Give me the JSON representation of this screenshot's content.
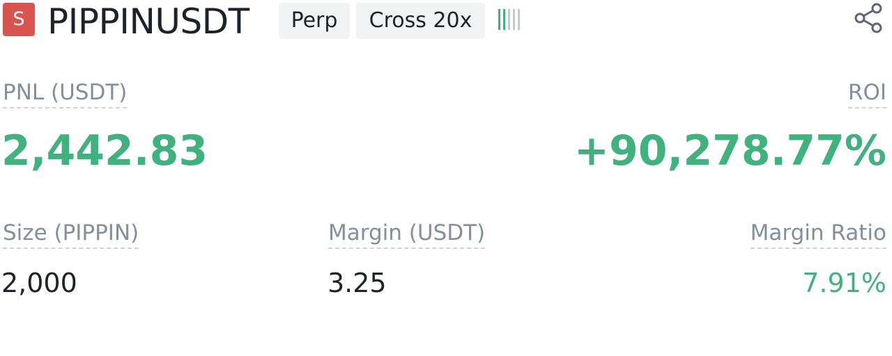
{
  "header": {
    "side_badge": "S",
    "symbol": "PIPPINUSDT",
    "contract_type": "Perp",
    "margin_mode": "Cross 20x",
    "risk_icon": "risk-level-bars-icon",
    "share_icon": "share-icon"
  },
  "pnl": {
    "label": "PNL (USDT)",
    "value": "2,442.83"
  },
  "roi": {
    "label": "ROI",
    "value": "+90,278.77%"
  },
  "size": {
    "label": "Size (PIPPIN)",
    "value": "2,000"
  },
  "margin": {
    "label": "Margin (USDT)",
    "value": "3.25"
  },
  "margin_ratio": {
    "label": "Margin Ratio",
    "value": "7.91%"
  },
  "colors": {
    "profit_green": "#3fb27f",
    "sell_red": "#d9534f",
    "label_gray": "#848e9c",
    "text_dark": "#1e2329",
    "tag_bg": "#f2f3f5"
  }
}
